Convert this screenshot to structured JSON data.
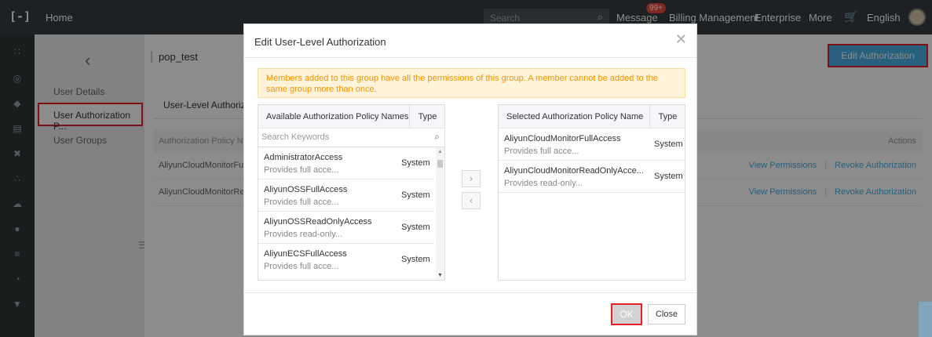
{
  "topbar": {
    "logo": "[-]",
    "home": "Home",
    "search_placeholder": "Search",
    "message": "Message",
    "message_badge": "99+",
    "billing": "Billing Management",
    "enterprise": "Enterprise",
    "more": "More",
    "language": "English"
  },
  "sidebar": {
    "items": [
      "User Details",
      "User Authorization P...",
      "User Groups"
    ]
  },
  "main": {
    "breadcrumb": "pop_test",
    "edit_button": "Edit Authorization Policy",
    "tab": "User-Level Authorization",
    "table_header": "Authorization Policy Name",
    "actions_header": "Actions",
    "rows": [
      {
        "name": "AliyunCloudMonitorFullAcc",
        "view": "View Permissions",
        "revoke": "Revoke Authorization"
      },
      {
        "name": "AliyunCloudMonitorReadOr",
        "view": "View Permissions",
        "revoke": "Revoke Authorization"
      }
    ]
  },
  "modal": {
    "title": "Edit User-Level Authorization",
    "notice": "Members added to this group have all the permissions of this group. A member cannot be added to the same group more than once.",
    "left_panel": {
      "header_name": "Available Authorization Policy Names",
      "header_type": "Type",
      "search_placeholder": "Search Keywords",
      "items": [
        {
          "name": "AdministratorAccess",
          "desc": "Provides full acce...",
          "type": "System"
        },
        {
          "name": "AliyunOSSFullAccess",
          "desc": "Provides full acce...",
          "type": "System"
        },
        {
          "name": "AliyunOSSReadOnlyAccess",
          "desc": "Provides read-only...",
          "type": "System"
        },
        {
          "name": "AliyunECSFullAccess",
          "desc": "Provides full acce...",
          "type": "System"
        }
      ]
    },
    "right_panel": {
      "header_name": "Selected Authorization Policy Name",
      "header_type": "Type",
      "items": [
        {
          "name": "AliyunCloudMonitorFullAccess",
          "desc": "Provides full acce...",
          "type": "System"
        },
        {
          "name": "AliyunCloudMonitorReadOnlyAcce...",
          "desc": "Provides read-only...",
          "type": "System"
        }
      ]
    },
    "ok": "OK",
    "close": "Close"
  },
  "colors": {
    "accent": "#4ab0e4",
    "highlight_border": "#e0202a",
    "notice_text": "#f29200"
  }
}
